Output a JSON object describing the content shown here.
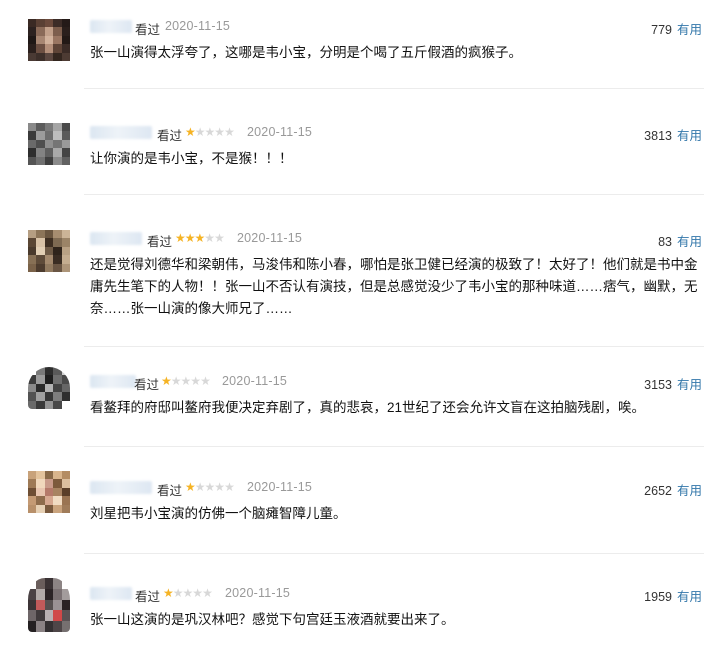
{
  "comments": [
    {
      "seen": "看过",
      "rating": 0,
      "date": "2020-11-15",
      "votes": "779",
      "useful": "有用",
      "text": "张一山演得太浮夸了，这哪是韦小宝，分明是个喝了五斤假酒的疯猴子。"
    },
    {
      "seen": "看过",
      "rating": 1,
      "date": "2020-11-15",
      "votes": "3813",
      "useful": "有用",
      "text": "让你演的是韦小宝，不是猴！！！"
    },
    {
      "seen": "看过",
      "rating": 3,
      "date": "2020-11-15",
      "votes": "83",
      "useful": "有用",
      "text": "还是觉得刘德华和梁朝伟，马浚伟和陈小春，哪怕是张卫健已经演的极致了！太好了！他们就是书中金庸先生笔下的人物！！张一山不否认有演技，但是总感觉没少了韦小宝的那种味道……痞气，幽默，无奈……张一山演的像大师兄了……"
    },
    {
      "seen": "看过",
      "rating": 1,
      "date": "2020-11-15",
      "votes": "3153",
      "useful": "有用",
      "text": "看鳌拜的府邸叫鳌府我便决定弃剧了，真的悲哀，21世纪了还会允许文盲在这拍脑残剧，唉。"
    },
    {
      "seen": "看过",
      "rating": 1,
      "date": "2020-11-15",
      "votes": "2652",
      "useful": "有用",
      "text": "刘星把韦小宝演的仿佛一个脑瘫智障儿童。"
    },
    {
      "seen": "看过",
      "rating": 1,
      "date": "2020-11-15",
      "votes": "1959",
      "useful": "有用",
      "text": "张一山这演的是巩汉林吧？感觉下句宫廷玉液酒就要出来了。"
    }
  ],
  "colors": {
    "star_on": "#f5b324",
    "star_off": "#d8d8d8",
    "useful_link": "#3377aa",
    "date": "#999999"
  },
  "icons": {
    "star": "star-icon"
  }
}
